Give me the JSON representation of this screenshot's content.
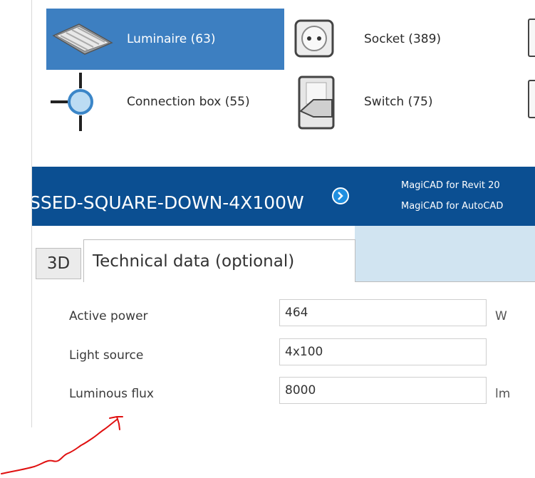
{
  "categories": {
    "luminaire": {
      "label": "Luminaire (63)",
      "icon": "luminaire-icon",
      "selected": true
    },
    "socket": {
      "label": "Socket (389)",
      "icon": "socket-icon"
    },
    "connection_box": {
      "label": "Connection box (55)",
      "icon": "connection-box-icon"
    },
    "switch": {
      "label": "Switch (75)",
      "icon": "switch-icon"
    }
  },
  "banner": {
    "product_name": "SSED-SQUARE-DOWN-4X100W",
    "line1": "MagiCAD for Revit 20",
    "line2": "MagiCAD for AutoCAD",
    "color": "#0b4f92"
  },
  "tabs": {
    "tab_3d": "3D",
    "tab_technical": "Technical data (optional)"
  },
  "fields": {
    "active_power": {
      "label": "Active power",
      "value": "464",
      "unit": "W"
    },
    "light_source": {
      "label": "Light source",
      "value": "4x100"
    },
    "luminous_flux": {
      "label": "Luminous flux",
      "value": "8000",
      "unit": "lm"
    }
  },
  "colors": {
    "selected_bg": "#3d7fc1",
    "tab_bg": "#d1e4f1",
    "annotation": "#e01010"
  }
}
